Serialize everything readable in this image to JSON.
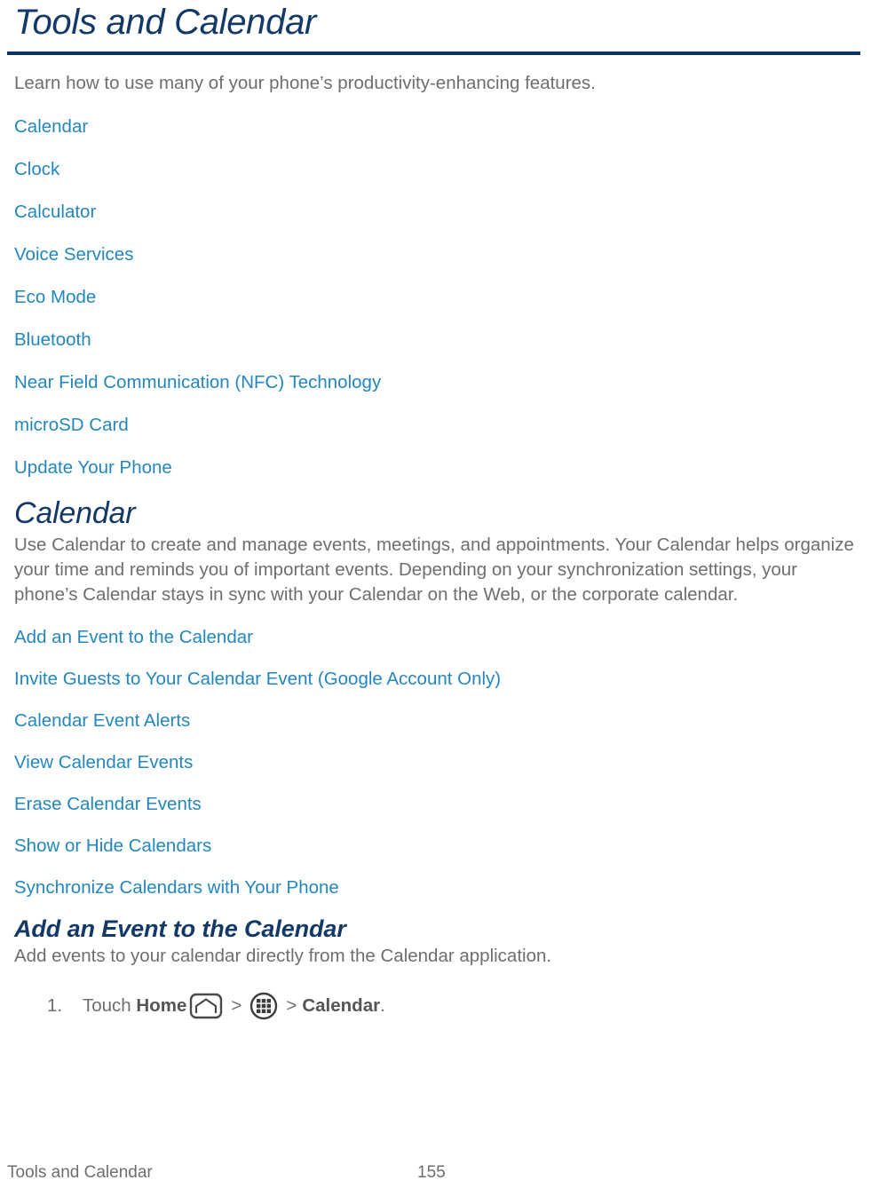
{
  "page": {
    "title": "Tools and Calendar",
    "intro": "Learn how to use many of your phone’s productivity-enhancing features."
  },
  "colors": {
    "heading_navy": "#133a67",
    "rule_navy": "#0d3360",
    "link_blue": "#2387bd",
    "body_gray": "#6e6e6e"
  },
  "toc_primary": [
    {
      "label": "Calendar"
    },
    {
      "label": "Clock"
    },
    {
      "label": "Calculator"
    },
    {
      "label": "Voice Services"
    },
    {
      "label": "Eco Mode"
    },
    {
      "label": "Bluetooth"
    },
    {
      "label": "Near Field Communication (NFC) Technology"
    },
    {
      "label": "microSD Card"
    },
    {
      "label": "Update Your Phone"
    }
  ],
  "calendar_section": {
    "heading": "Calendar",
    "description": "Use Calendar to create and manage events, meetings, and appointments. Your Calendar helps organize your time and reminds you of important events. Depending on your synchronization settings, your phone’s Calendar stays in sync with your Calendar on the Web, or the corporate calendar.",
    "toc_secondary": [
      {
        "label": "Add an Event to the Calendar"
      },
      {
        "label": "Invite Guests to Your Calendar Event (Google Account Only)"
      },
      {
        "label": "Calendar Event Alerts"
      },
      {
        "label": "View Calendar Events"
      },
      {
        "label": "Erase Calendar Events"
      },
      {
        "label": "Show or Hide Calendars"
      },
      {
        "label": "Synchronize Calendars with Your Phone"
      }
    ]
  },
  "add_event_section": {
    "heading": "Add an Event to the Calendar",
    "description": "Add events to your calendar directly from the Calendar application.",
    "steps": [
      {
        "number": "1.",
        "lead": "Touch ",
        "home_label": "Home",
        "home_icon": "home-icon",
        "separator_1": ">",
        "apps_icon": "apps-grid-icon",
        "separator_2": ">",
        "target_label": "Calendar",
        "period": "."
      }
    ]
  },
  "footer": {
    "left_label": "Tools and Calendar",
    "page_number": "155"
  }
}
